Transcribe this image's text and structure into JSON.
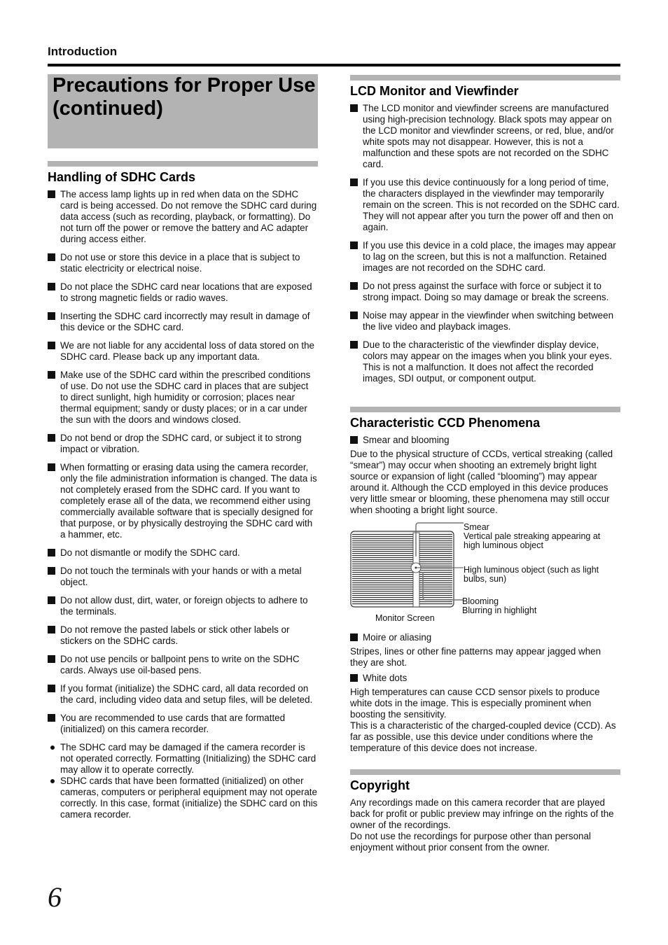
{
  "header": {
    "section": "Introduction"
  },
  "title": "Precautions for Proper Use (continued)",
  "sdhc": {
    "heading": "Handling of SDHC Cards",
    "items": [
      "The access lamp lights up in red when data on the SDHC card is being accessed. Do not remove the SDHC card during data access (such as recording, playback, or formatting). Do not turn off the power or remove the battery and AC adapter during access either.",
      "Do not use or store this device in a place that is subject to static electricity or electrical noise.",
      "Do not place the SDHC card near locations that are exposed to strong magnetic fields or radio waves.",
      "Inserting the SDHC card incorrectly may result in damage of this device or the SDHC card.",
      "We are not liable for any accidental loss of data stored on the SDHC card. Please back up any important data.",
      "Make use of the SDHC card within the prescribed conditions of use. Do not use the SDHC card in places that are subject to direct sunlight, high humidity or corrosion; places near thermal equipment; sandy or dusty places; or in a car under the sun with the doors and windows closed.",
      "Do not bend or drop the SDHC card, or subject it to strong impact or vibration.",
      "When formatting or erasing data using the camera recorder, only the file administration information is changed. The data is not completely erased from the SDHC card. If you want to completely erase all of the data, we recommend either using commercially available software that is specially designed for that purpose, or by physically destroying the SDHC card with a hammer, etc.",
      "Do not dismantle or modify the SDHC card.",
      "Do not touch the terminals with your hands or with a metal object.",
      "Do not allow dust, dirt, water, or foreign objects to adhere to the terminals.",
      "Do not remove the pasted labels or stick other labels or stickers on the SDHC cards.",
      "Do not use pencils or ballpoint pens to write on the SDHC cards. Always use oil-based pens.",
      "If you format (initialize) the SDHC card, all data recorded on the card, including video data and setup files, will be deleted.",
      "You are recommended to use cards that are formatted (initialized) on this camera recorder."
    ],
    "bullets": [
      "The SDHC card may be damaged if the camera recorder is not operated correctly. Formatting (Initializing) the SDHC card may allow it to operate correctly.",
      "SDHC cards that have been formatted (initialized) on other cameras, computers or peripheral equipment may not operate correctly. In this case, format (initialize) the SDHC card on this camera recorder."
    ]
  },
  "lcd": {
    "heading": "LCD Monitor and Viewfinder",
    "items": [
      "The LCD monitor and viewfinder screens are manufactured using high-precision technology. Black spots may appear on the LCD monitor and viewfinder screens, or red, blue, and/or white spots may not disappear. However, this is not a malfunction and these spots are not recorded on the SDHC card.",
      "If you use this device continuously for a long period of time, the characters displayed in the viewfinder may temporarily remain on the screen. This is not recorded on the SDHC card. They will not appear after you turn the power off and then on again.",
      "If you use this device in a cold place, the images may appear to lag on the screen, but this is not a malfunction. Retained images are not recorded on the SDHC card.",
      "Do not press against the surface with force or subject it to strong impact. Doing so may damage or break the screens.",
      "Noise may appear in the viewfinder when switching between the live video and playback images.",
      "Due to the characteristic of the viewfinder display device, colors may appear on the images when you blink your eyes. This is not a malfunction. It does not affect the recorded images, SDI output, or component output."
    ]
  },
  "ccd": {
    "heading": "Characteristic CCD Phenomena",
    "smear_title": "Smear and blooming",
    "smear_text": "Due to the physical structure of CCDs, vertical streaking (called “smear”) may occur when shooting an extremely bright light source or expansion of light (called “blooming”) may appear around it. Although the CCD employed in this device produces very little smear or blooming, these phenomena may still occur when shooting a bright light source.",
    "figure": {
      "smear_label": "Smear",
      "smear_desc": "Vertical pale streaking appearing at high luminous object",
      "object_label": "High luminous object (such as light bulbs, sun)",
      "blooming_label": "Blooming",
      "blooming_desc": "Blurring in highlight",
      "caption": "Monitor Screen"
    },
    "moire_title": "Moire or aliasing",
    "moire_text": "Stripes, lines or other fine patterns may appear jagged when they are shot.",
    "white_title": "White dots",
    "white_text_1": "High temperatures can cause CCD sensor pixels to produce white dots in the image. This is especially prominent when boosting the sensitivity.",
    "white_text_2": "This is a characteristic of the charged-coupled device (CCD). As far as possible, use this device under conditions where the temperature of this device does not increase."
  },
  "copyright": {
    "heading": "Copyright",
    "text_1": "Any recordings made on this camera recorder that are played back for profit or public preview may infringe on the rights of the owner of the recordings.",
    "text_2": "Do not use the recordings for purpose other than personal enjoyment without prior consent from the owner."
  },
  "page_number": "6"
}
